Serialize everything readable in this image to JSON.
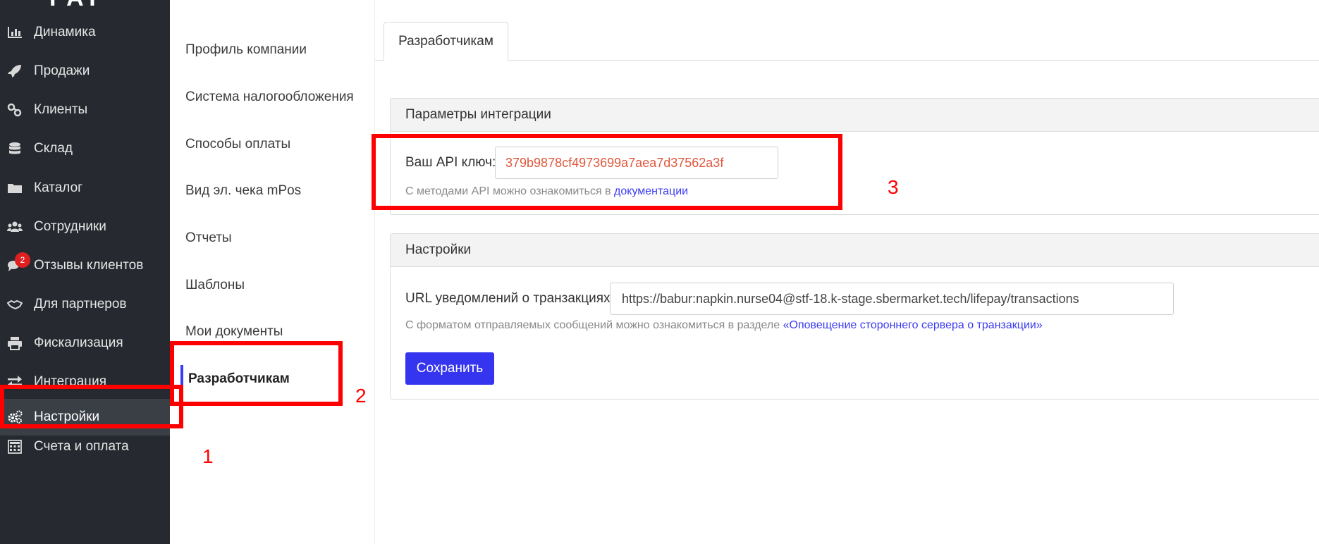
{
  "sidebar": {
    "logo": "PAY",
    "items": [
      {
        "label": "Динамика",
        "icon": "bar-chart-icon"
      },
      {
        "label": "Продажи",
        "icon": "rocket-icon"
      },
      {
        "label": "Клиенты",
        "icon": "link-icon"
      },
      {
        "label": "Склад",
        "icon": "database-icon"
      },
      {
        "label": "Каталог",
        "icon": "folder-icon"
      },
      {
        "label": "Сотрудники",
        "icon": "users-icon"
      },
      {
        "label": "Отзывы клиентов",
        "icon": "comments-icon",
        "badge": "2"
      },
      {
        "label": "Для партнеров",
        "icon": "handshake-icon"
      },
      {
        "label": "Фискализация",
        "icon": "printer-icon"
      },
      {
        "label": "Интеграция",
        "icon": "exchange-icon"
      },
      {
        "label": "Настройки",
        "icon": "gears-icon",
        "active": true
      },
      {
        "label": "Счета и оплата",
        "icon": "calculator-icon"
      }
    ]
  },
  "submenu": {
    "items": [
      {
        "label": "Профиль компании"
      },
      {
        "label": "Система налогообложения"
      },
      {
        "label": "Способы оплаты"
      },
      {
        "label": "Вид эл. чека mPos"
      },
      {
        "label": "Отчеты"
      },
      {
        "label": "Шаблоны"
      },
      {
        "label": "Мои документы"
      },
      {
        "label": "Разработчикам",
        "active": true
      }
    ]
  },
  "main": {
    "tab_label": "Разработчикам",
    "integration": {
      "title": "Параметры интеграции",
      "api_key_label": "Ваш API ключ:",
      "api_key_value": "379b9878cf4973699a7aea7d37562a3f",
      "hint_prefix": "С методами API можно ознакомиться в ",
      "hint_link": "документации"
    },
    "settings": {
      "title": "Настройки",
      "url_label": "URL уведомлений о транзакциях:",
      "url_value": "https://babur:napkin.nurse04@stf-18.k-stage.sbermarket.tech/lifepay/transactions",
      "hint_prefix": "С форматом отправляемых сообщений можно ознакомиться в разделе ",
      "hint_link": "«Оповещение стороннего сервера о транзакции»",
      "save_label": "Сохранить"
    }
  },
  "annotations": {
    "num1": "1",
    "num2": "2",
    "num3": "3"
  },
  "colors": {
    "sidebar_bg": "#262a30",
    "accent": "#3535f0",
    "annotation": "#ff0000",
    "api_key_text": "#e0573d"
  }
}
